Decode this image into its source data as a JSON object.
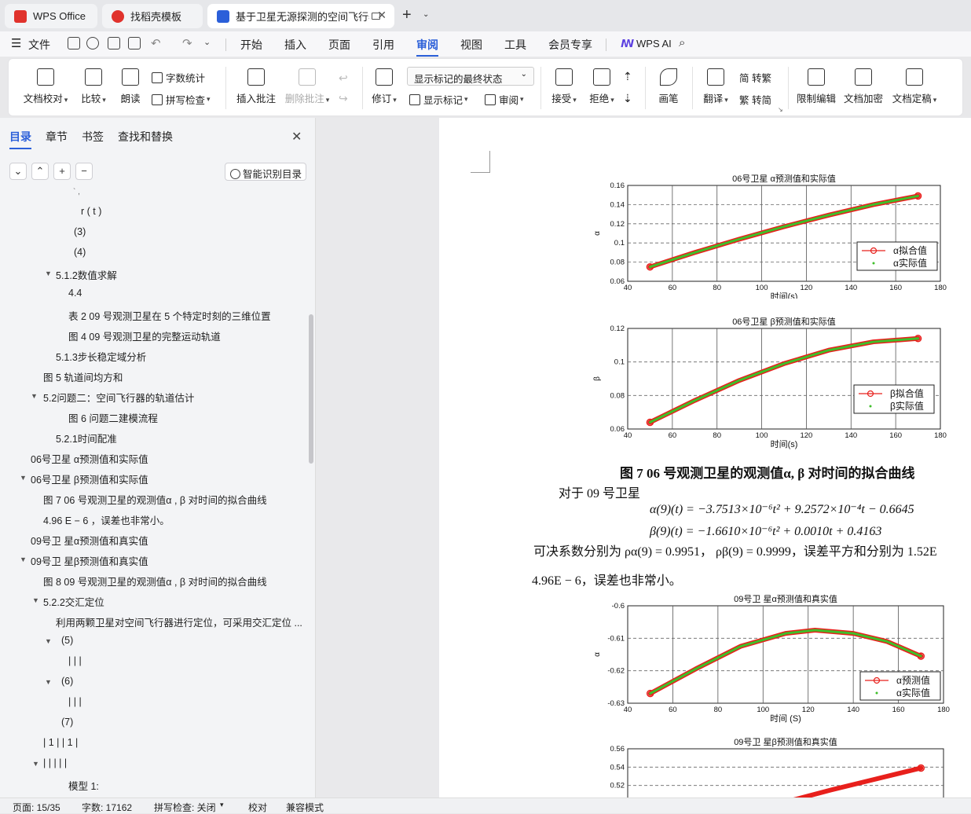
{
  "tabs": [
    {
      "label": "WPS Office"
    },
    {
      "label": "找稻壳模板"
    },
    {
      "label": "基于卫星无源探测的空间飞行器"
    }
  ],
  "menu": {
    "file": "文件",
    "items": [
      "开始",
      "插入",
      "页面",
      "引用",
      "审阅",
      "视图",
      "工具",
      "会员专享"
    ],
    "active": "审阅",
    "ai": "WPS AI"
  },
  "ribbon": {
    "doc_check": "文档校对",
    "compare": "比较",
    "read_aloud": "朗读",
    "word_count": "字数统计",
    "spell_check": "拼写检查",
    "insert_comment": "插入批注",
    "delete_comment": "删除批注",
    "revise": "修订",
    "display_select": "显示标记的最终状态",
    "show_markup": "显示标记",
    "review": "审阅",
    "accept": "接受",
    "reject": "拒绝",
    "pen": "画笔",
    "translate": "翻译",
    "trad": "简 转繁",
    "simp": "繁 转简",
    "restrict": "限制编辑",
    "encrypt": "文档加密",
    "finalize": "文档定稿"
  },
  "panel": {
    "tabs": [
      "目录",
      "章节",
      "书签",
      "查找和替换"
    ],
    "smart_btn": "智能识别目录",
    "toc": [
      {
        "text": "r ( t )"
      },
      {
        "text": "(3)"
      },
      {
        "text": "(4)"
      },
      {
        "text": "5.1.2数值求解"
      },
      {
        "text": "4.4"
      },
      {
        "text": "表 2 09 号观测卫星在 5 个特定时刻的三维位置"
      },
      {
        "text": "图 4 09 号观测卫星的完整运动轨道"
      },
      {
        "text": "5.1.3步长稳定域分析"
      },
      {
        "text": "图 5 轨道间均方和"
      },
      {
        "text": "5.2问题二：空间飞行器的轨道估计"
      },
      {
        "text": "图 6 问题二建模流程"
      },
      {
        "text": "5.2.1时间配准"
      },
      {
        "text": "06号卫星 α预测值和实际值"
      },
      {
        "text": "06号卫星 β预测值和实际值"
      },
      {
        "text": "图 7 06 号观测卫星的观测值α , β 对时间的拟合曲线"
      },
      {
        "text": "4.96 E − 6 ，误差也非常小。"
      },
      {
        "text": "09号卫 星α预测值和真实值"
      },
      {
        "text": "09号卫 星β预测值和真实值"
      },
      {
        "text": "图 8 09 号观测卫星的观测值α , β 对时间的拟合曲线"
      },
      {
        "text": "5.2.2交汇定位"
      },
      {
        "text": "利用两颗卫星对空间飞行器进行定位，可采用交汇定位 ..."
      },
      {
        "text": "(5)"
      },
      {
        "text": "| | |"
      },
      {
        "text": "(6)"
      },
      {
        "text": "| | |"
      },
      {
        "text": "(7)"
      },
      {
        "text": "| 1 |  | 1 |"
      },
      {
        "text": "| | | | |"
      },
      {
        "text": "模型 1:"
      }
    ]
  },
  "doc": {
    "fig7_caption": "图 7   06 号观测卫星的观测值α, β 对时间的拟合曲线",
    "para1": "对于 09 号卫星",
    "eq1": "α(9)(t) = −3.7513×10⁻⁶t² + 9.2572×10⁻⁴t − 0.6645",
    "eq2": "β(9)(t) = −1.6610×10⁻⁶t² + 0.0010t + 0.4163",
    "para2": "可决系数分别为 ρα(9) = 0.9951，  ρβ(9) = 0.9999，误差平方和分别为 1.52E",
    "para3": "4.96E − 6，误差也非常小。"
  },
  "charts": [
    {
      "title": "06号卫星  α预测值和实际值",
      "xlabel": "时间(s)",
      "ylabel": "α",
      "legend": [
        "α拟合值",
        "α实际值"
      ],
      "xticks": [
        "40",
        "60",
        "80",
        "100",
        "120",
        "140",
        "160",
        "180"
      ],
      "yticks": [
        "0.06",
        "0.08",
        "0.1",
        "0.12",
        "0.14",
        "0.16"
      ]
    },
    {
      "title": "06号卫星  β预测值和实际值",
      "xlabel": "时间(s)",
      "ylabel": "β",
      "legend": [
        "β拟合值",
        "β实际值"
      ],
      "xticks": [
        "40",
        "60",
        "80",
        "100",
        "120",
        "140",
        "160",
        "180"
      ],
      "yticks": [
        "0.06",
        "0.08",
        "0.1",
        "0.12"
      ]
    },
    {
      "title": "09号卫 星α预测值和真实值",
      "xlabel": "时间 (S)",
      "ylabel": "α",
      "legend": [
        "α预测值",
        "α实际值"
      ],
      "xticks": [
        "40",
        "60",
        "80",
        "100",
        "120",
        "140",
        "160",
        "180"
      ],
      "yticks": [
        "-0.63",
        "-0.62",
        "-0.61",
        "-0.6"
      ]
    },
    {
      "title": "09号卫 星β预测值和真实值",
      "xlabel": "",
      "ylabel": "",
      "legend": [],
      "xticks": [],
      "yticks": [
        "0.52",
        "0.54",
        "0.56"
      ]
    }
  ],
  "chart_data": [
    {
      "type": "line",
      "title": "06号卫星  α预测值和实际值",
      "xlabel": "时间(s)",
      "ylabel": "α",
      "xlim": [
        40,
        180
      ],
      "ylim": [
        0.06,
        0.16
      ],
      "series": [
        {
          "name": "α拟合值",
          "x": [
            50,
            70,
            90,
            110,
            130,
            150,
            170
          ],
          "y": [
            0.075,
            0.09,
            0.104,
            0.117,
            0.129,
            0.14,
            0.149
          ]
        },
        {
          "name": "α实际值",
          "x": [
            50,
            70,
            90,
            110,
            130,
            150,
            170
          ],
          "y": [
            0.075,
            0.09,
            0.104,
            0.117,
            0.129,
            0.14,
            0.149
          ]
        }
      ]
    },
    {
      "type": "line",
      "title": "06号卫星  β预测值和实际值",
      "xlabel": "时间(s)",
      "ylabel": "β",
      "xlim": [
        40,
        180
      ],
      "ylim": [
        0.06,
        0.12
      ],
      "series": [
        {
          "name": "β拟合值",
          "x": [
            50,
            70,
            90,
            110,
            130,
            150,
            170
          ],
          "y": [
            0.064,
            0.077,
            0.089,
            0.099,
            0.107,
            0.112,
            0.114
          ]
        },
        {
          "name": "β实际值",
          "x": [
            50,
            70,
            90,
            110,
            130,
            150,
            170
          ],
          "y": [
            0.064,
            0.077,
            0.089,
            0.099,
            0.107,
            0.112,
            0.114
          ]
        }
      ]
    },
    {
      "type": "line",
      "title": "09号卫 星α预测值和真实值",
      "xlabel": "时间 (S)",
      "ylabel": "α",
      "xlim": [
        40,
        180
      ],
      "ylim": [
        -0.63,
        -0.6
      ],
      "series": [
        {
          "name": "α预测值",
          "x": [
            50,
            70,
            90,
            110,
            123,
            140,
            155,
            170
          ],
          "y": [
            -0.627,
            -0.6195,
            -0.6125,
            -0.6085,
            -0.6075,
            -0.6085,
            -0.611,
            -0.6155
          ]
        },
        {
          "name": "α实际值",
          "x": [
            50,
            70,
            90,
            110,
            123,
            140,
            155,
            170
          ],
          "y": [
            -0.627,
            -0.6195,
            -0.6125,
            -0.6085,
            -0.6075,
            -0.6085,
            -0.611,
            -0.6155
          ]
        }
      ]
    },
    {
      "type": "line",
      "title": "09号卫 星β预测值和真实值",
      "xlim": [
        40,
        180
      ],
      "ylim": [
        0.5,
        0.56
      ],
      "series": [
        {
          "name": "",
          "x": [
            110,
            130,
            150,
            170
          ],
          "y": [
            0.502,
            0.515,
            0.527,
            0.539
          ]
        }
      ]
    }
  ],
  "status": {
    "page": "页面: 15/35",
    "words": "字数: 17162",
    "spell": "拼写检查: 关闭",
    "proof": "校对",
    "compat": "兼容模式"
  }
}
